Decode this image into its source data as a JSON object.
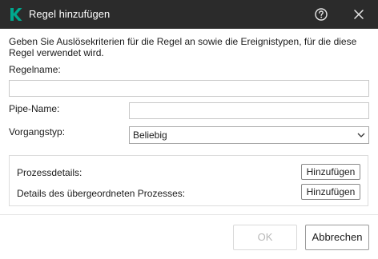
{
  "window": {
    "title": "Regel hinzufügen",
    "logo_icon": "kaspersky-k-logo",
    "accent": "#00a88e",
    "titlebar_bg": "#2b2b2b"
  },
  "description": "Geben Sie Auslösekriterien für die Regel an sowie die Ereignistypen, für die diese Regel verwendet wird.",
  "fields": {
    "rule_name": {
      "label": "Regelname:",
      "value": "",
      "placeholder": ""
    },
    "pipe_name": {
      "label": "Pipe-Name:",
      "value": "",
      "placeholder": ""
    },
    "operation_type": {
      "label": "Vorgangstyp:",
      "selected": "Beliebig"
    }
  },
  "process_group": {
    "process_details": {
      "label": "Prozessdetails:",
      "button": "Hinzufügen"
    },
    "parent_details": {
      "label": "Details des übergeordneten Prozesses:",
      "button": "Hinzufügen"
    }
  },
  "footer": {
    "ok": {
      "label": "OK",
      "enabled": false
    },
    "cancel": {
      "label": "Abbrechen",
      "enabled": true
    }
  }
}
